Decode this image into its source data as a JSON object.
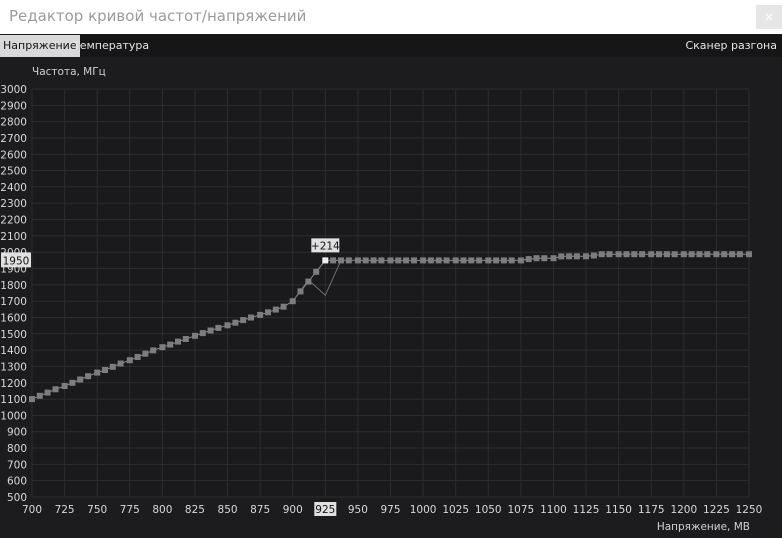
{
  "window": {
    "title": "Редактор кривой частот/напряжений",
    "close_label": "×"
  },
  "tabs": [
    {
      "label": "Напряжение",
      "active": true
    },
    {
      "label": "Температура",
      "active": false
    }
  ],
  "scanner_label": "Сканер разгона",
  "selected_point": {
    "voltage": "925",
    "frequency": "1950",
    "offset": "+214"
  },
  "colors": {
    "background": "#1c1c1e",
    "grid": "#2c2c2f",
    "curve": "#7d7d7d",
    "highlight": "#e0e0e0"
  },
  "chart_data": {
    "type": "line",
    "ylabel": "Частота, МГц",
    "xlabel": "Напряжение, МВ",
    "xlim": [
      700,
      1250
    ],
    "ylim": [
      500,
      3000
    ],
    "x_ticks": [
      "700",
      "725",
      "750",
      "775",
      "800",
      "825",
      "850",
      "875",
      "900",
      "925",
      "950",
      "975",
      "1000",
      "1025",
      "1050",
      "1075",
      "1100",
      "1125",
      "1150",
      "1175",
      "1200",
      "1225",
      "1250"
    ],
    "y_ticks": [
      "3000",
      "2900",
      "2800",
      "2700",
      "2600",
      "2500",
      "2400",
      "2300",
      "2200",
      "2100",
      "2000",
      "1900",
      "1800",
      "1700",
      "1600",
      "1500",
      "1400",
      "1300",
      "1200",
      "1100",
      "1000",
      "900",
      "800",
      "700",
      "600",
      "500"
    ],
    "grid": true,
    "series": [
      {
        "x": [
          700,
          706,
          712,
          718,
          725,
          731,
          737,
          743,
          750,
          756,
          762,
          768,
          775,
          781,
          787,
          793,
          800,
          806,
          812,
          818,
          825,
          831,
          837,
          843,
          850,
          856,
          862,
          868,
          875,
          881,
          887,
          893,
          900,
          906,
          912,
          918,
          925,
          931,
          937,
          943,
          950,
          956,
          962,
          968,
          975,
          981,
          987,
          993,
          1000,
          1006,
          1012,
          1018,
          1025,
          1031,
          1037,
          1043,
          1050,
          1056,
          1062,
          1068,
          1075,
          1081,
          1087,
          1093,
          1100,
          1106,
          1112,
          1118,
          1125,
          1131,
          1137,
          1143,
          1150,
          1156,
          1162,
          1168,
          1175,
          1181,
          1187,
          1193,
          1200,
          1206,
          1212,
          1218,
          1225,
          1231,
          1237,
          1243,
          1250
        ],
        "values": [
          1100,
          1120,
          1140,
          1160,
          1180,
          1200,
          1220,
          1240,
          1262,
          1278,
          1298,
          1318,
          1338,
          1358,
          1378,
          1398,
          1418,
          1434,
          1452,
          1468,
          1488,
          1504,
          1520,
          1536,
          1552,
          1568,
          1584,
          1600,
          1616,
          1632,
          1648,
          1666,
          1700,
          1760,
          1820,
          1880,
          1950,
          1950,
          1950,
          1950,
          1950,
          1950,
          1950,
          1950,
          1950,
          1950,
          1950,
          1950,
          1950,
          1950,
          1950,
          1950,
          1950,
          1950,
          1950,
          1950,
          1950,
          1950,
          1950,
          1950,
          1950,
          1958,
          1963,
          1963,
          1963,
          1974,
          1975,
          1975,
          1975,
          1980,
          1988,
          1988,
          1988,
          1988,
          1988,
          1988,
          1988,
          1988,
          1988,
          1988,
          1988,
          1988,
          1988,
          1988,
          1988,
          1988,
          1988,
          1988,
          1988
        ]
      },
      {
        "x": [
          900,
          912,
          925,
          937,
          950
        ],
        "values": [
          1700,
          1830,
          1736,
          1950,
          1950
        ]
      }
    ]
  }
}
